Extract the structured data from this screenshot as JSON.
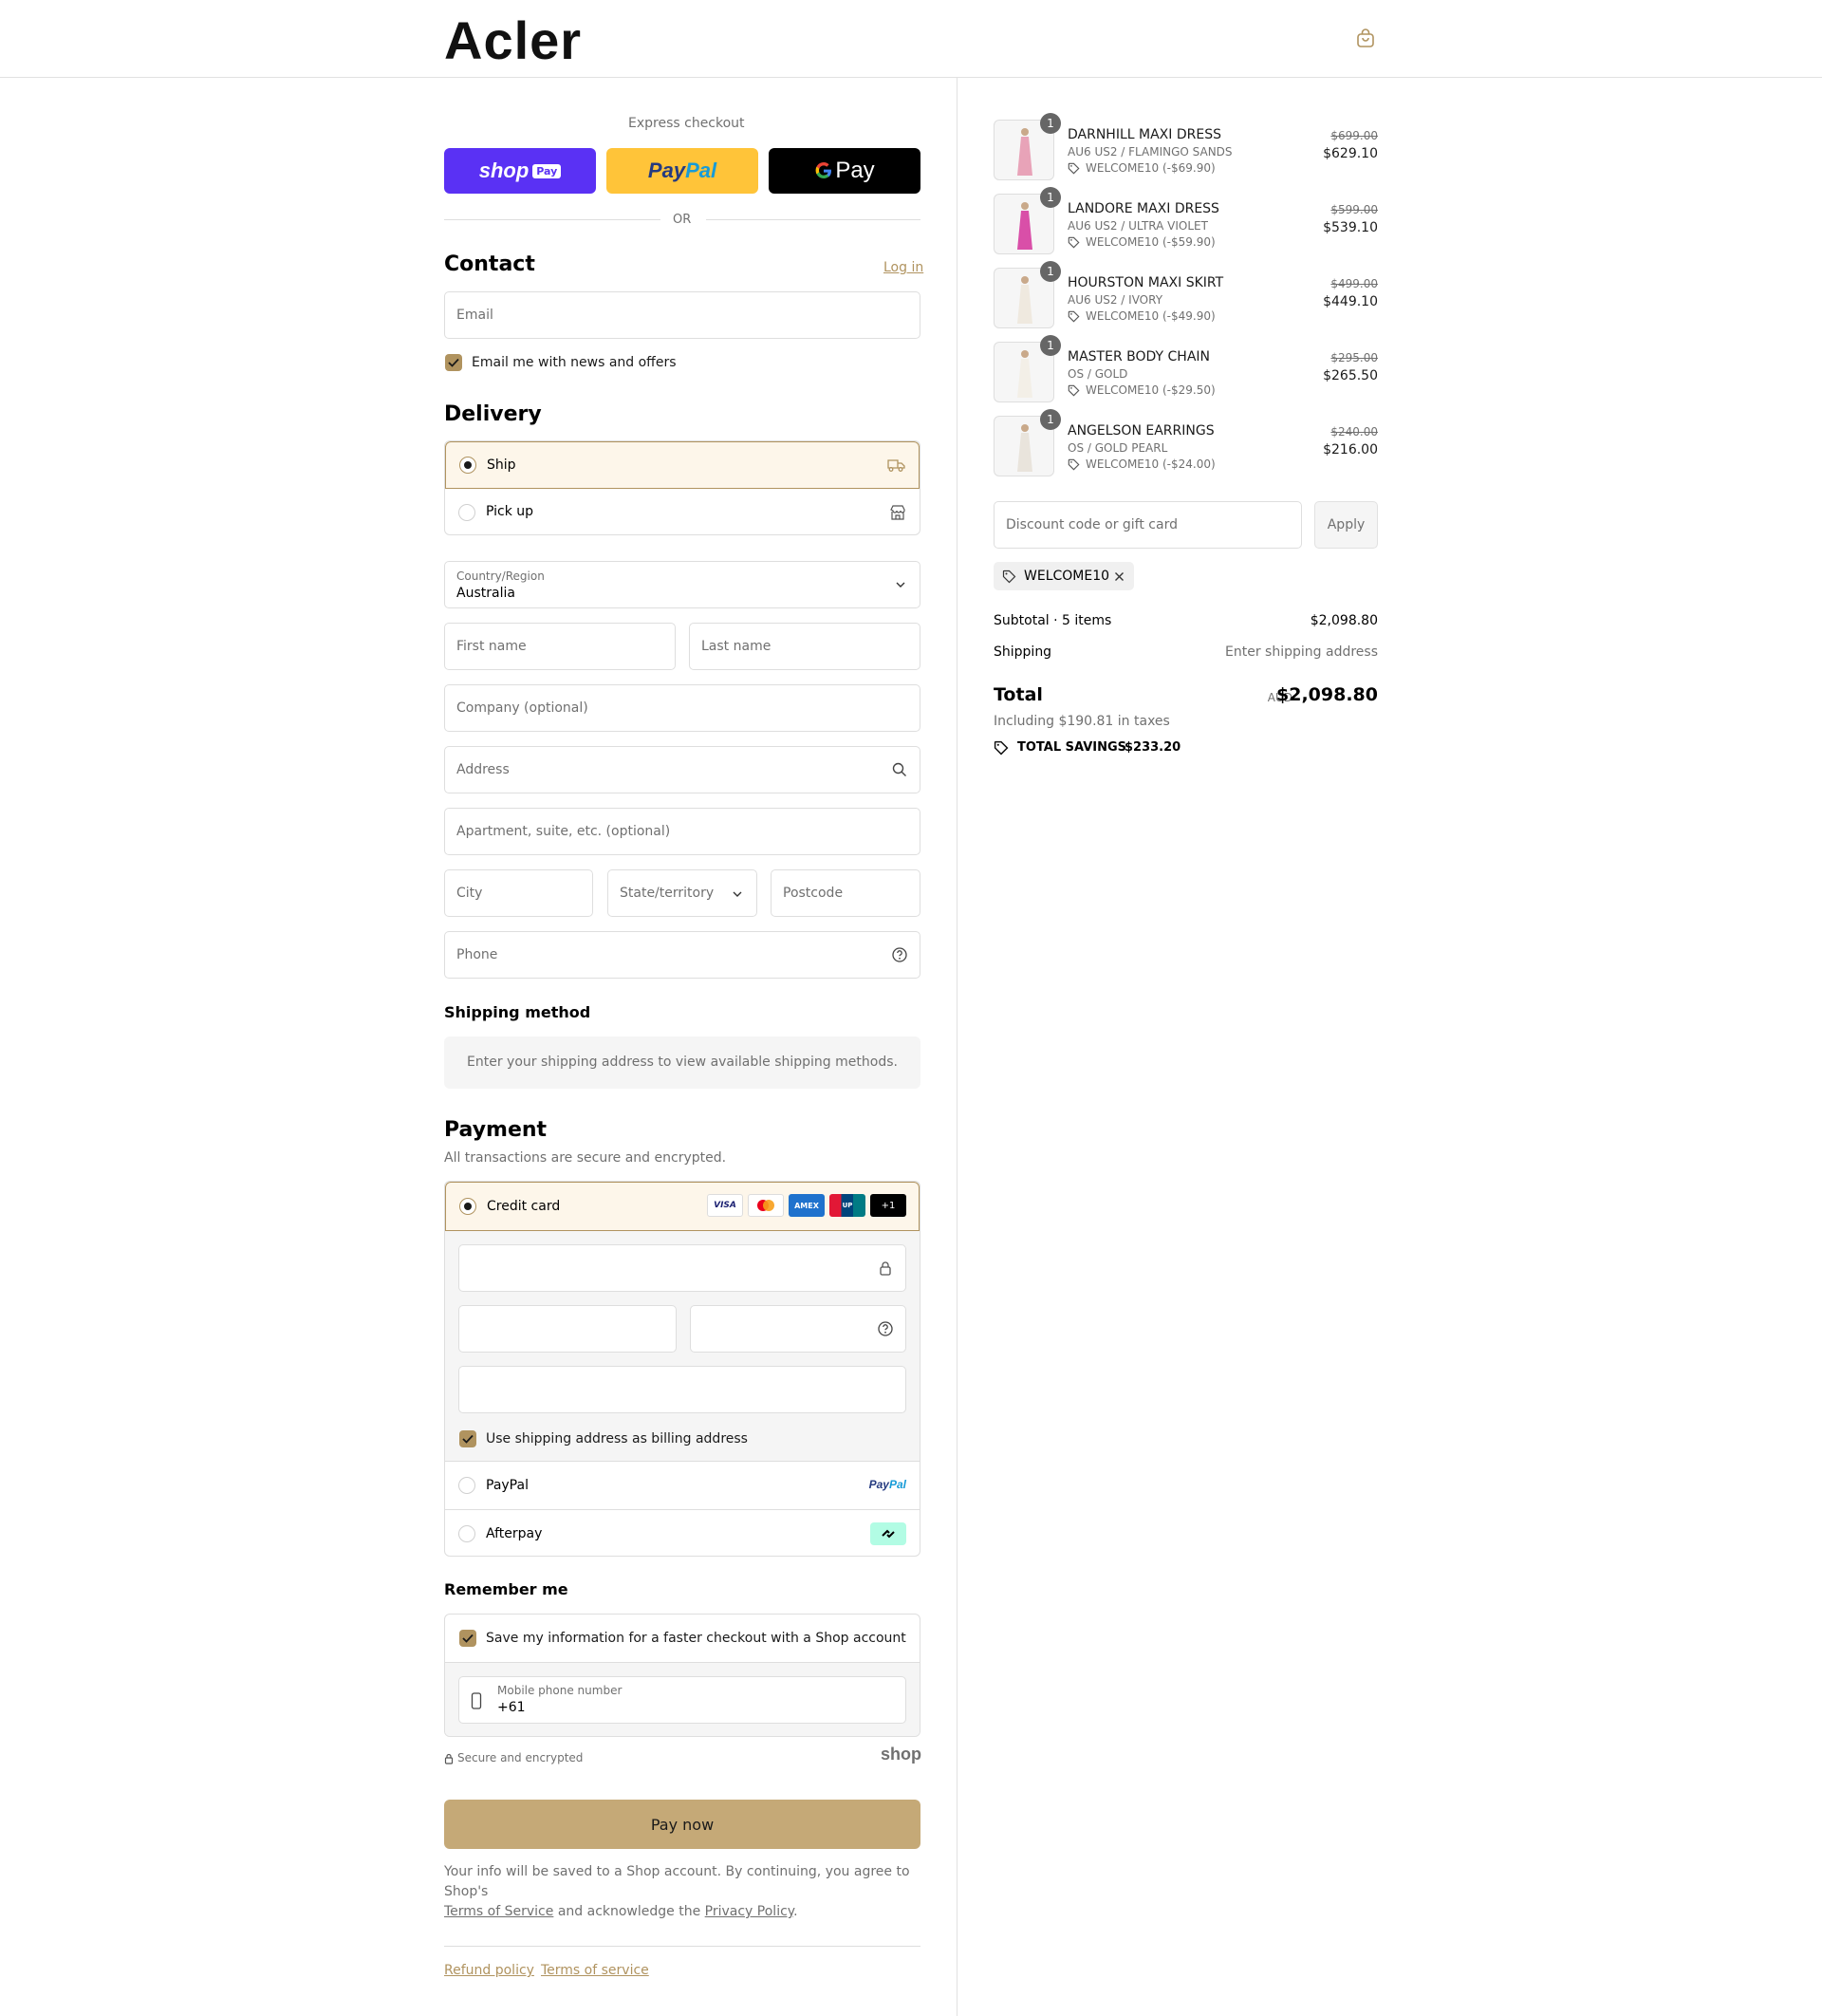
{
  "brand": {
    "logo": "Acler"
  },
  "express": {
    "label": "Express checkout",
    "shop_label": "shop",
    "shop_pay_badge": "Pay",
    "paypal_label1": "Pay",
    "paypal_label2": "Pal",
    "gpay_label": "Pay",
    "or": "OR"
  },
  "contact": {
    "title": "Contact",
    "login": "Log in",
    "email_placeholder": "Email",
    "news_label": "Email me with news and offers"
  },
  "delivery": {
    "title": "Delivery",
    "ship": "Ship",
    "pickup": "Pick up",
    "country_label": "Country/Region",
    "country_value": "Australia",
    "first_name": "First name",
    "last_name": "Last name",
    "company": "Company (optional)",
    "address": "Address",
    "apartment": "Apartment, suite, etc. (optional)",
    "city": "City",
    "state": "State/territory",
    "postcode": "Postcode",
    "phone": "Phone"
  },
  "shipping_method": {
    "title": "Shipping method",
    "message": "Enter your shipping address to view available shipping methods."
  },
  "payment": {
    "title": "Payment",
    "subtitle": "All transactions are secure and encrypted.",
    "credit_card": "Credit card",
    "card_more": "+1",
    "billing_label": "Use shipping address as billing address",
    "paypal": "PayPal",
    "afterpay": "Afterpay"
  },
  "remember": {
    "title": "Remember me",
    "save_label": "Save my information for a faster checkout with a Shop account",
    "phone_label": "Mobile phone number",
    "phone_value": "+61",
    "secure": "Secure and encrypted",
    "shop": "shop"
  },
  "pay_button": "Pay now",
  "legal": {
    "line1": "Your info will be saved to a Shop account. By continuing, you agree to Shop's",
    "terms": "Terms of Service",
    "mid": " and acknowledge the ",
    "privacy": "Privacy Policy",
    "end": "."
  },
  "footer": {
    "refund": "Refund policy",
    "terms": "Terms of service"
  },
  "cart": {
    "items": [
      {
        "qty": "1",
        "name": "DARNHILL MAXI DRESS",
        "variant": "AU6 US2 / FLAMINGO SANDS",
        "discount": "WELCOME10 (-$69.90)",
        "original": "$699.00",
        "price": "$629.10",
        "color": "#e8a3b8"
      },
      {
        "qty": "1",
        "name": "LANDORE MAXI DRESS",
        "variant": "AU6 US2 / ULTRA VIOLET",
        "discount": "WELCOME10 (-$59.90)",
        "original": "$599.00",
        "price": "$539.10",
        "color": "#d94fa8"
      },
      {
        "qty": "1",
        "name": "HOURSTON MAXI SKIRT",
        "variant": "AU6 US2 / IVORY",
        "discount": "WELCOME10 (-$49.90)",
        "original": "$499.00",
        "price": "$449.10",
        "color": "#efe9df"
      },
      {
        "qty": "1",
        "name": "MASTER BODY CHAIN",
        "variant": "OS / GOLD",
        "discount": "WELCOME10 (-$29.50)",
        "original": "$295.00",
        "price": "$265.50",
        "color": "#f3efe7"
      },
      {
        "qty": "1",
        "name": "ANGELSON EARRINGS",
        "variant": "OS / GOLD PEARL",
        "discount": "WELCOME10 (-$24.00)",
        "original": "$240.00",
        "price": "$216.00",
        "color": "#e9e4dc"
      }
    ],
    "discount_placeholder": "Discount code or gift card",
    "apply": "Apply",
    "code": "WELCOME10",
    "subtotal_label": "Subtotal · 5 items",
    "subtotal_value": "$2,098.80",
    "shipping_label": "Shipping",
    "shipping_value": "Enter shipping address",
    "total_label": "Total",
    "currency": "AUD",
    "total_value": "$2,098.80",
    "taxes": "Including $190.81 in taxes",
    "savings_label": "TOTAL SAVINGS",
    "savings_value": "$233.20"
  },
  "colors": {
    "accent": "#b0935f",
    "shop_pay": "#5a31f4",
    "paypal": "#ffc439",
    "button": "#c5a977"
  }
}
